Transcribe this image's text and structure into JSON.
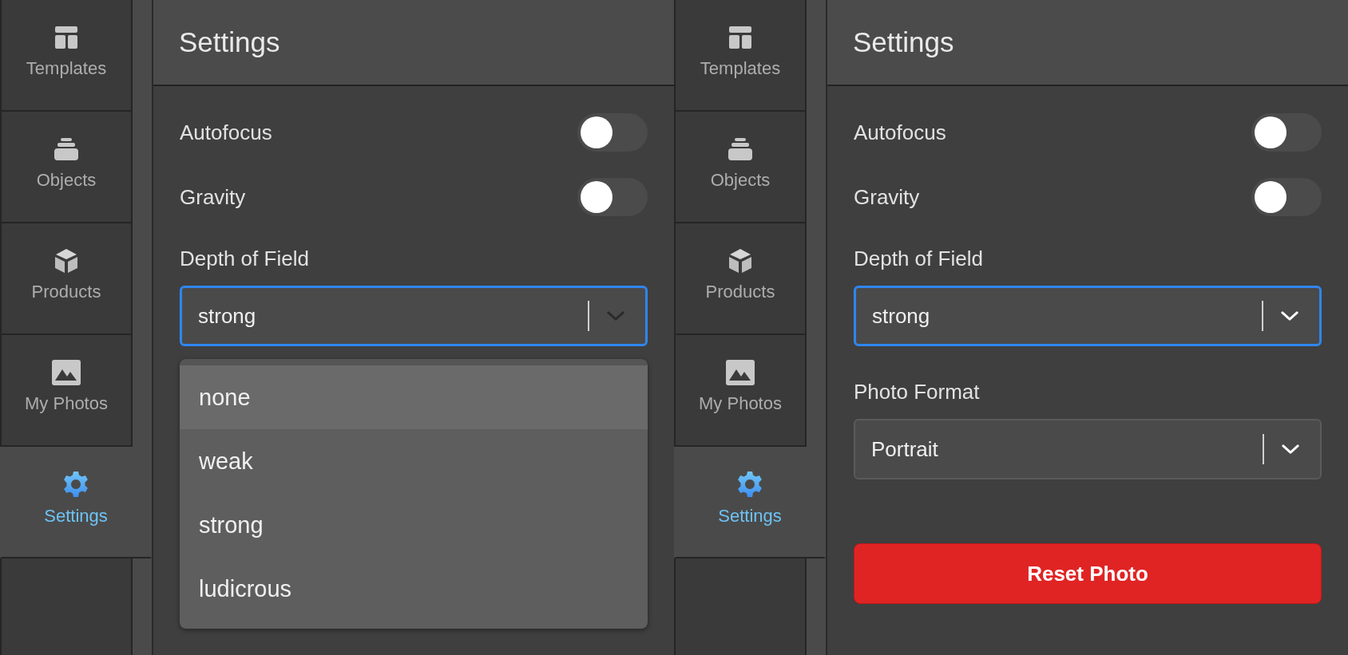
{
  "screens": [
    {
      "sidebar": {
        "items": [
          {
            "label": "Templates",
            "selected": false
          },
          {
            "label": "Objects",
            "selected": false
          },
          {
            "label": "Products",
            "selected": false
          },
          {
            "label": "My Photos",
            "selected": false
          },
          {
            "label": "Settings",
            "selected": true
          }
        ]
      },
      "header": {
        "title": "Settings"
      },
      "settings": [
        {
          "kind": "toggle",
          "label": "Autofocus",
          "on": false
        },
        {
          "kind": "toggle",
          "label": "Gravity",
          "on": false
        },
        {
          "kind": "select",
          "label": "Depth of Field",
          "value": "strong",
          "focused": true,
          "open": true,
          "options": [
            {
              "label": "none",
              "highlighted": true
            },
            {
              "label": "weak",
              "highlighted": false
            },
            {
              "label": "strong",
              "highlighted": false
            },
            {
              "label": "ludicrous",
              "highlighted": false
            }
          ]
        }
      ]
    },
    {
      "sidebar": {
        "items": [
          {
            "label": "Templates",
            "selected": false
          },
          {
            "label": "Objects",
            "selected": false
          },
          {
            "label": "Products",
            "selected": false
          },
          {
            "label": "My Photos",
            "selected": false
          },
          {
            "label": "Settings",
            "selected": true
          }
        ]
      },
      "header": {
        "title": "Settings"
      },
      "settings": [
        {
          "kind": "toggle",
          "label": "Autofocus",
          "on": false
        },
        {
          "kind": "toggle",
          "label": "Gravity",
          "on": false
        },
        {
          "kind": "select",
          "label": "Depth of Field",
          "value": "strong",
          "focused": true,
          "open": false
        },
        {
          "kind": "select",
          "label": "Photo Format",
          "value": "Portrait",
          "focused": false,
          "open": false
        },
        {
          "kind": "button",
          "label": "Reset Photo"
        }
      ]
    }
  ]
}
